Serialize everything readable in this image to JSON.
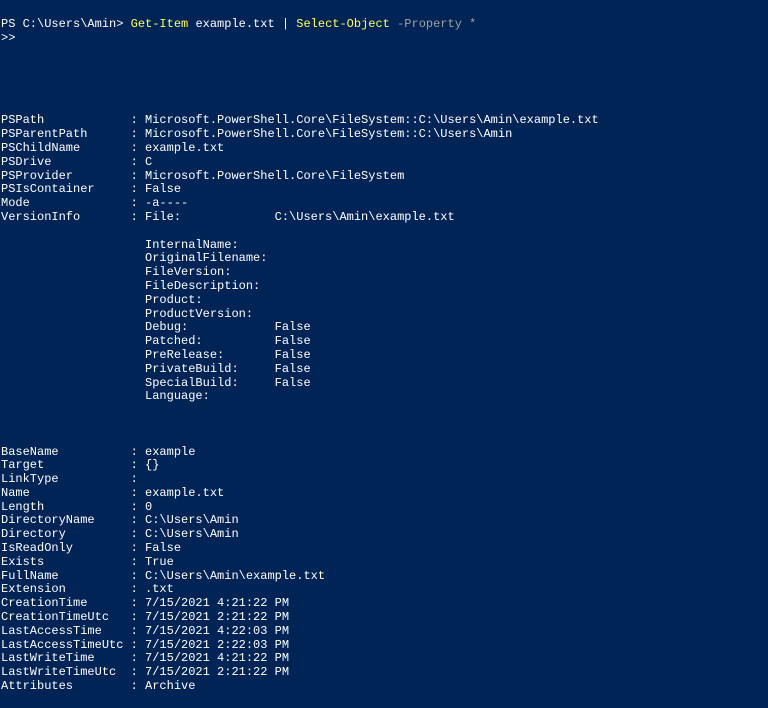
{
  "prompt": {
    "ps": "PS C:\\Users\\Amin> ",
    "cmd1": "Get-Item ",
    "arg1": "example.txt ",
    "pipe": "| ",
    "cmd2": "Select-Object ",
    "param": "-Property *"
  },
  "continuation": ">>",
  "rows": [
    {
      "k": "PSPath",
      "v": "Microsoft.PowerShell.Core\\FileSystem::C:\\Users\\Amin\\example.txt"
    },
    {
      "k": "PSParentPath",
      "v": "Microsoft.PowerShell.Core\\FileSystem::C:\\Users\\Amin"
    },
    {
      "k": "PSChildName",
      "v": "example.txt"
    },
    {
      "k": "PSDrive",
      "v": "C"
    },
    {
      "k": "PSProvider",
      "v": "Microsoft.PowerShell.Core\\FileSystem"
    },
    {
      "k": "PSIsContainer",
      "v": "False"
    },
    {
      "k": "Mode",
      "v": "-a----"
    },
    {
      "k": "VersionInfo",
      "v": "File:             C:\\Users\\Amin\\example.txt"
    }
  ],
  "versioninfo_extra": [
    "InternalName:",
    "OriginalFilename:",
    "FileVersion:",
    "FileDescription:",
    "Product:",
    "ProductVersion:",
    "Debug:            False",
    "Patched:          False",
    "PreRelease:       False",
    "PrivateBuild:     False",
    "SpecialBuild:     False",
    "Language:"
  ],
  "rows2": [
    {
      "k": "BaseName",
      "v": "example"
    },
    {
      "k": "Target",
      "v": "{}"
    },
    {
      "k": "LinkType",
      "v": ""
    },
    {
      "k": "Name",
      "v": "example.txt"
    },
    {
      "k": "Length",
      "v": "0"
    },
    {
      "k": "DirectoryName",
      "v": "C:\\Users\\Amin"
    },
    {
      "k": "Directory",
      "v": "C:\\Users\\Amin"
    },
    {
      "k": "IsReadOnly",
      "v": "False"
    },
    {
      "k": "Exists",
      "v": "True"
    },
    {
      "k": "FullName",
      "v": "C:\\Users\\Amin\\example.txt"
    },
    {
      "k": "Extension",
      "v": ".txt"
    },
    {
      "k": "CreationTime",
      "v": "7/15/2021 4:21:22 PM"
    },
    {
      "k": "CreationTimeUtc",
      "v": "7/15/2021 2:21:22 PM"
    },
    {
      "k": "LastAccessTime",
      "v": "7/15/2021 4:22:03 PM"
    },
    {
      "k": "LastAccessTimeUtc",
      "v": "7/15/2021 2:22:03 PM"
    },
    {
      "k": "LastWriteTime",
      "v": "7/15/2021 4:21:22 PM"
    },
    {
      "k": "LastWriteTimeUtc",
      "v": "7/15/2021 2:21:22 PM"
    },
    {
      "k": "Attributes",
      "v": "Archive"
    }
  ]
}
